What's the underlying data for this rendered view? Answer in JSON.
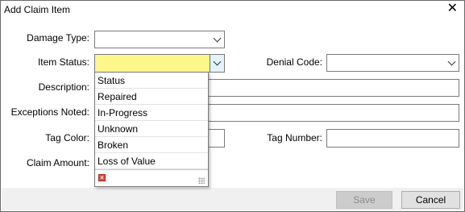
{
  "dialog": {
    "title": "Add Claim Item",
    "close_glyph": "✕"
  },
  "form": {
    "damage_type_label": "Damage Type:",
    "damage_type_value": "",
    "item_status_label": "Item Status:",
    "item_status_value": "",
    "denial_code_label": "Denial Code:",
    "denial_code_value": "",
    "description_label": "Description:",
    "description_value": "",
    "exceptions_label": "Exceptions Noted:",
    "exceptions_value": "",
    "tag_color_label": "Tag Color:",
    "tag_color_value": "",
    "tag_number_label": "Tag Number:",
    "tag_number_value": "",
    "claim_amount_label": "Claim Amount:"
  },
  "item_status_dropdown": {
    "options": [
      "Status",
      "Repaired",
      "In-Progress",
      "Unknown",
      "Broken",
      "Loss of Value"
    ],
    "clear_icon": "clear-icon",
    "resize_icon": "resize-grip-icon"
  },
  "buttons": {
    "save": "Save",
    "cancel": "Cancel"
  },
  "colors": {
    "active_field": "#fdf68a",
    "footer_bg": "#f0f0f0"
  }
}
